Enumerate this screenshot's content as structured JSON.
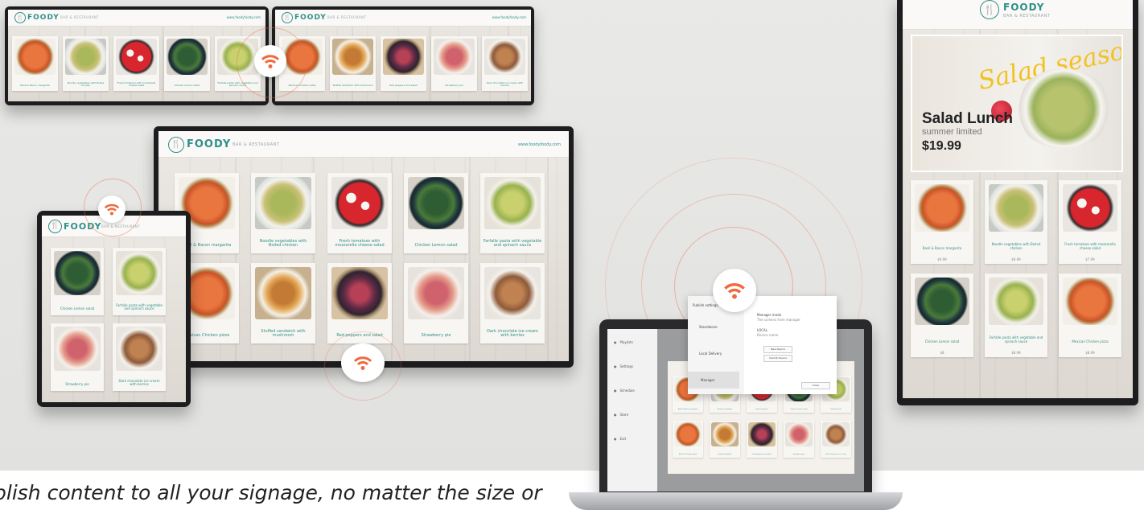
{
  "caption": "blish content to all your signage, no matter the size or",
  "brand": {
    "name": "FOODY",
    "tagline": "BAR & RESTAURANT",
    "badge_glyph": "🍴",
    "accent": "#2f8f8a",
    "url": "www.foodyfoody.com"
  },
  "wifi": {
    "icon": "wifi-icon",
    "color": "#f06a40"
  },
  "main_tv": {
    "items": [
      {
        "label": "Basil & Bacon margarita",
        "food": "pizza"
      },
      {
        "label": "Noodle vegetables with Boiled chicken",
        "food": "salad"
      },
      {
        "label": "Fresh tomatoes with mozzarella cheese salad",
        "food": "tomato"
      },
      {
        "label": "Chicken Lemon salad",
        "food": "green"
      },
      {
        "label": "Farfalle pasta with vegetable and spinach sauce",
        "food": "pasta"
      },
      {
        "label": "Mexican Chicken pizza",
        "food": "pizza"
      },
      {
        "label": "Stuffed sandwich with mushroom",
        "food": "bun"
      },
      {
        "label": "Red peppers and salad",
        "food": "berry"
      },
      {
        "label": "Strawberry pie",
        "food": "pie"
      },
      {
        "label": "Dark chocolate ice cream with berries",
        "food": "cake"
      }
    ]
  },
  "top_left_tv": {
    "items": [
      {
        "label": "Basil & Bacon margarita",
        "food": "pizza"
      },
      {
        "label": "Noodle vegetables with Boiled chicken",
        "food": "salad"
      },
      {
        "label": "Fresh tomatoes with mozzarella cheese salad",
        "food": "tomato"
      },
      {
        "label": "Chicken Lemon salad",
        "food": "green"
      },
      {
        "label": "Farfalle pasta with vegetable and spinach sauce",
        "food": "pasta"
      }
    ]
  },
  "top_right_tv": {
    "items": [
      {
        "label": "Mexican Chicken pizza",
        "food": "pizza"
      },
      {
        "label": "Stuffed sandwich with mushroom",
        "food": "bun"
      },
      {
        "label": "Red peppers and salad",
        "food": "berry"
      },
      {
        "label": "Strawberry pie",
        "food": "pie"
      },
      {
        "label": "Dark chocolate ice cream with berries",
        "food": "cake"
      }
    ]
  },
  "tablet": {
    "items": [
      {
        "label": "Chicken Lemon salad",
        "food": "green"
      },
      {
        "label": "Farfalle pasta with vegetable and spinach sauce",
        "food": "pasta"
      },
      {
        "label": "Strawberry pie",
        "food": "pie"
      },
      {
        "label": "Dark chocolate ice cream with berries",
        "food": "cake"
      }
    ]
  },
  "portrait": {
    "promo": {
      "script": "Salad season!",
      "title": "Salad Lunch",
      "subtitle": "summer limited",
      "price": "$19.99"
    },
    "items": [
      {
        "label": "Basil & Bacon margarita",
        "price": "$9.99",
        "food": "pizza"
      },
      {
        "label": "Noodle vegetables with Boiled chicken",
        "price": "$9.99",
        "food": "salad"
      },
      {
        "label": "Fresh tomatoes with mozzarella cheese salad",
        "price": "$7.99",
        "food": "tomato"
      },
      {
        "label": "Chicken Lemon salad",
        "price": "$8",
        "food": "green"
      },
      {
        "label": "Farfalle pasta with vegetable and spinach sauce",
        "price": "$8.99",
        "food": "pasta"
      },
      {
        "label": "Mexican Chicken pizza",
        "price": "$8.99",
        "food": "pizza"
      }
    ]
  },
  "laptop": {
    "sidebar": [
      {
        "label": "Playlists",
        "icon": "playlist-icon"
      },
      {
        "label": "Settings",
        "icon": "gear-icon"
      },
      {
        "label": "Schedule",
        "icon": "calendar-icon"
      },
      {
        "label": "Store",
        "icon": "store-icon"
      },
      {
        "label": "Exit",
        "icon": "exit-icon"
      }
    ],
    "dialog": {
      "title": "Publish settings",
      "tabs": [
        "Standalone",
        "Local Delivery",
        "Manager"
      ],
      "heading": "Manager mode",
      "subheading": "The screens from manager",
      "field_label": "LOCAL",
      "field_value": "Device name",
      "button1": "New Device",
      "button2": "Submit Device",
      "close": "Close"
    },
    "items": [
      {
        "label": "Basil & Bacon margarita",
        "food": "pizza"
      },
      {
        "label": "Noodle vegetables",
        "food": "salad"
      },
      {
        "label": "Fresh tomatoes",
        "food": "tomato"
      },
      {
        "label": "Chicken Lemon salad",
        "food": "green"
      },
      {
        "label": "Farfalle pasta",
        "food": "pasta"
      },
      {
        "label": "Mexican Chicken pizza",
        "food": "pizza"
      },
      {
        "label": "Stuffed sandwich",
        "food": "bun"
      },
      {
        "label": "Red peppers and salad",
        "food": "berry"
      },
      {
        "label": "Strawberry pie",
        "food": "pie"
      },
      {
        "label": "Dark chocolate ice cream",
        "food": "cake"
      }
    ]
  }
}
